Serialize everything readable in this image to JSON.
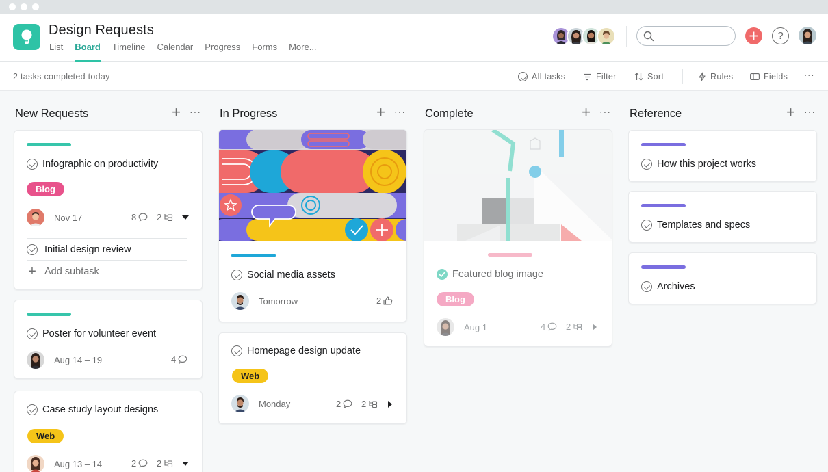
{
  "project": {
    "title": "Design Requests",
    "tabs": [
      "List",
      "Board",
      "Timeline",
      "Calendar",
      "Progress",
      "Forms",
      "More..."
    ],
    "active_tab": "Board",
    "accent": "#2ec3a6"
  },
  "toolbar": {
    "status": "2 tasks completed today",
    "all_tasks": "All tasks",
    "filter": "Filter",
    "sort": "Sort",
    "rules": "Rules",
    "fields": "Fields"
  },
  "icons": [
    "app-logo-icon",
    "search-icon",
    "plus-icon",
    "help-icon",
    "check-circle-icon",
    "filter-icon",
    "sort-icon",
    "lightning-icon",
    "fields-icon",
    "comment-icon",
    "subtask-icon",
    "like-icon",
    "caret-down-icon",
    "caret-right-icon"
  ],
  "columns": [
    {
      "title": "New Requests",
      "cards": [
        {
          "title": "Infographic on productivity",
          "bar_color": "#37c5ab",
          "tag": "Blog",
          "date": "Nov 17",
          "comments": "8",
          "subtasks": "2",
          "subtask_items": [
            "Initial design review"
          ],
          "add_subtask": "Add subtask"
        },
        {
          "title": "Poster for volunteer event",
          "bar_color": "#37c5ab",
          "date": "Aug 14 – 19",
          "comments": "4"
        },
        {
          "title": "Case study layout designs",
          "tag": "Web",
          "date": "Aug 13 – 14",
          "comments": "2",
          "subtasks": "2"
        }
      ]
    },
    {
      "title": "In Progress",
      "cards": [
        {
          "title": "Social media assets",
          "bar_color": "#1ea7d8",
          "date": "Tomorrow",
          "likes": "2"
        },
        {
          "title": "Homepage design update",
          "tag": "Web",
          "date": "Monday",
          "comments": "2",
          "subtasks": "2"
        }
      ]
    },
    {
      "title": "Complete",
      "cards": [
        {
          "title": "Featured blog image",
          "bar_color": "#f7b9c9",
          "tag": "Blog",
          "date": "Aug 1",
          "comments": "4",
          "subtasks": "2",
          "completed": true
        }
      ]
    },
    {
      "title": "Reference",
      "cards": [
        {
          "title": "How this project works",
          "bar_color": "#7a6ee0"
        },
        {
          "title": "Templates and specs",
          "bar_color": "#7a6ee0"
        },
        {
          "title": "Archives",
          "bar_color": "#7a6ee0"
        }
      ]
    }
  ]
}
